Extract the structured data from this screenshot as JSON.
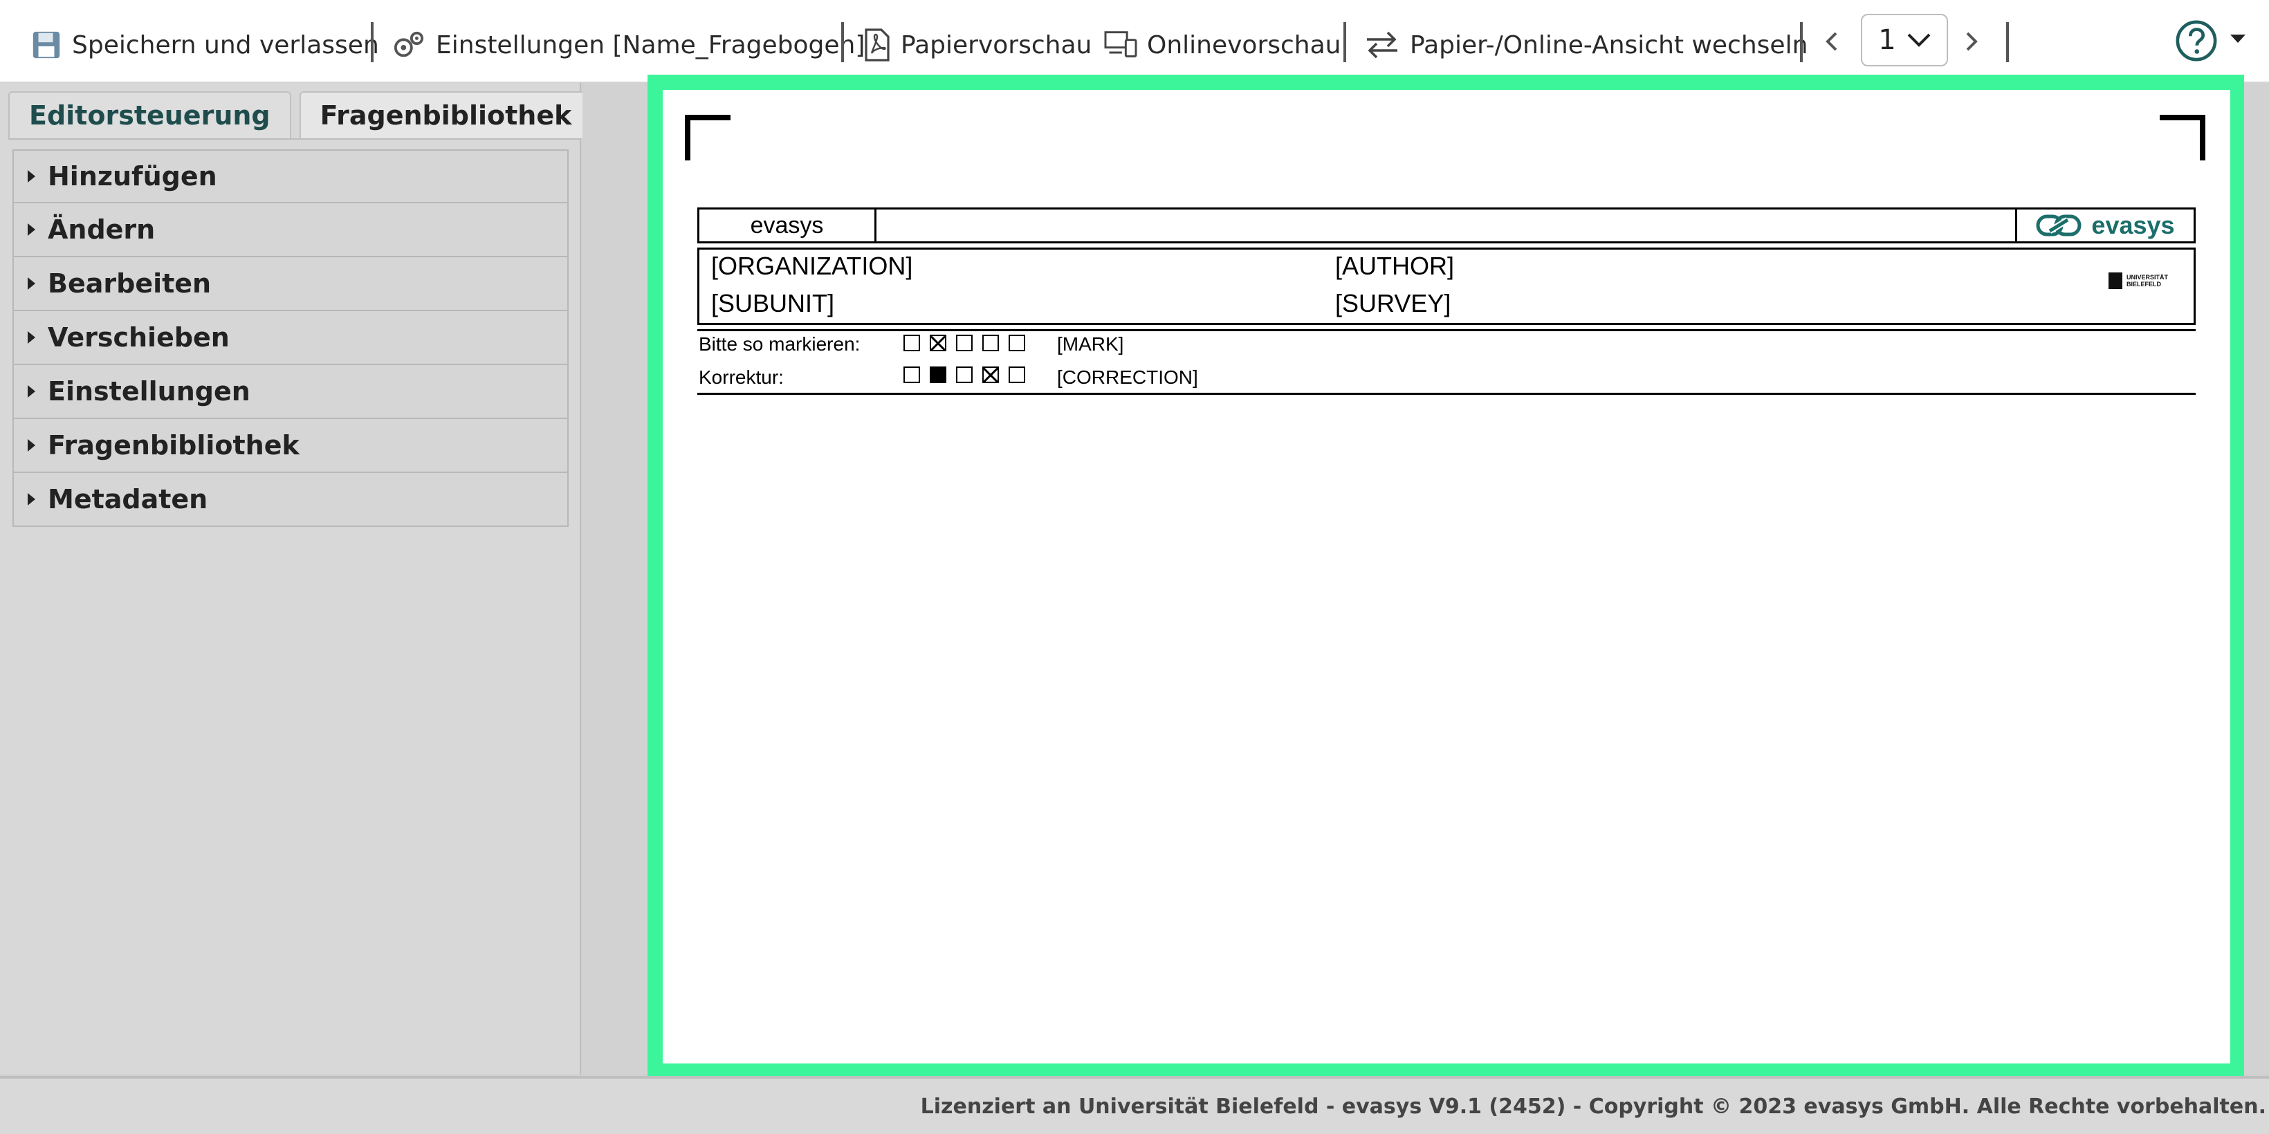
{
  "toolbar": {
    "save_label": "Speichern und verlassen",
    "settings_label": "Einstellungen [Name_Fragebogen]",
    "paper_preview_label": "Papiervorschau",
    "online_preview_label": "Onlinevorschau",
    "switch_view_label": "Papier-/Online-Ansicht wechseln",
    "page_number": "1"
  },
  "left_panel": {
    "tabs": [
      {
        "label": "Editorsteuerung",
        "active": true
      },
      {
        "label": "Fragenbibliothek",
        "active": false
      }
    ],
    "sections": [
      {
        "label": "Hinzufügen"
      },
      {
        "label": "Ändern"
      },
      {
        "label": "Bearbeiten"
      },
      {
        "label": "Verschieben"
      },
      {
        "label": "Einstellungen"
      },
      {
        "label": "Fragenbibliothek"
      },
      {
        "label": "Metadaten"
      }
    ]
  },
  "page": {
    "header_left": "evasys",
    "header_logo": "evasys",
    "organization": "[ORGANIZATION]",
    "subunit": "[SUBUNIT]",
    "author": "[AUTHOR]",
    "survey": "[SURVEY]",
    "university_logo_line1": "UNIVERSITÄT",
    "university_logo_line2": "BIELEFELD",
    "mark_label": "Bitte so markieren:",
    "mark_tag": "[MARK]",
    "correction_label": "Korrektur:",
    "correction_tag": "[CORRECTION]"
  },
  "footer": {
    "text": "Lizenziert an Universität Bielefeld - evasys V9.1 (2452) - Copyright © 2023 evasys GmbH. Alle Rechte vorbehalten."
  },
  "colors": {
    "frame_highlight": "#3cf59a",
    "brand_teal": "#1b6e6a",
    "active_tab_text": "#1f4d4d"
  }
}
